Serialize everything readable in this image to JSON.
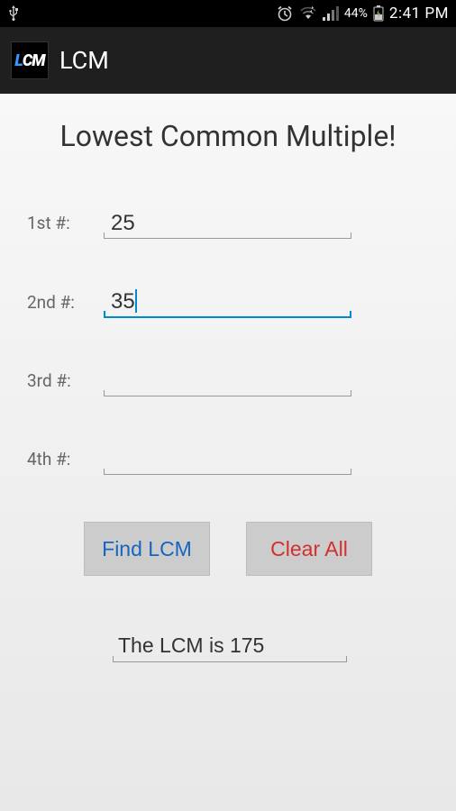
{
  "status": {
    "battery_text": "44%",
    "time": "2:41 PM"
  },
  "actionbar": {
    "title": "LCM",
    "icon_l": "L",
    "icon_cm": "CM"
  },
  "page": {
    "title": "Lowest Common Multiple!"
  },
  "fields": {
    "f1": {
      "label": "1st #:",
      "value": "25"
    },
    "f2": {
      "label": "2nd #:",
      "value": "35"
    },
    "f3": {
      "label": "3rd #:",
      "value": ""
    },
    "f4": {
      "label": "4th #:",
      "value": ""
    }
  },
  "buttons": {
    "find": "Find LCM",
    "clear": "Clear All"
  },
  "result": {
    "text": "The LCM is 175"
  }
}
